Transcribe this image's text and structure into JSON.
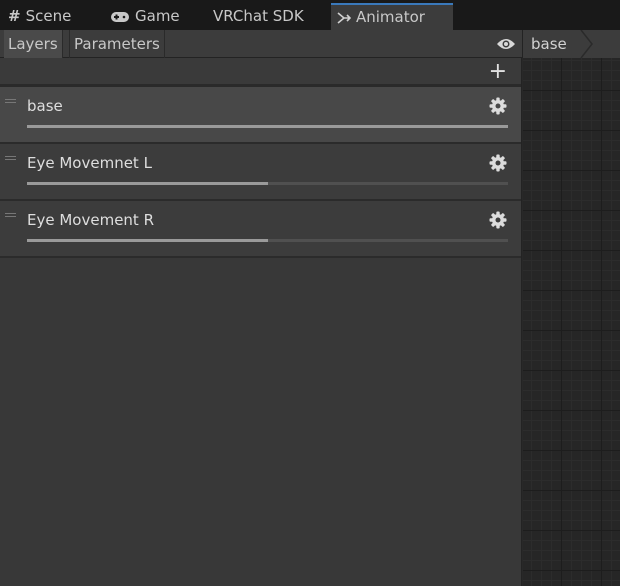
{
  "tabs": [
    {
      "label": "Scene",
      "icon": "grid-icon"
    },
    {
      "label": "Game",
      "icon": "gamepad-icon"
    },
    {
      "label": "VRChat SDK"
    },
    {
      "label": "Animator",
      "icon": "animator-icon",
      "active": true
    }
  ],
  "subtabs": {
    "layers": "Layers",
    "parameters": "Parameters"
  },
  "breadcrumb": "base",
  "layers": [
    {
      "name": "base",
      "weight": 1.0,
      "selected": true
    },
    {
      "name": "Eye Movemnet L",
      "weight": 0.5
    },
    {
      "name": "Eye Movement R",
      "weight": 0.5
    }
  ],
  "add_label": "+"
}
